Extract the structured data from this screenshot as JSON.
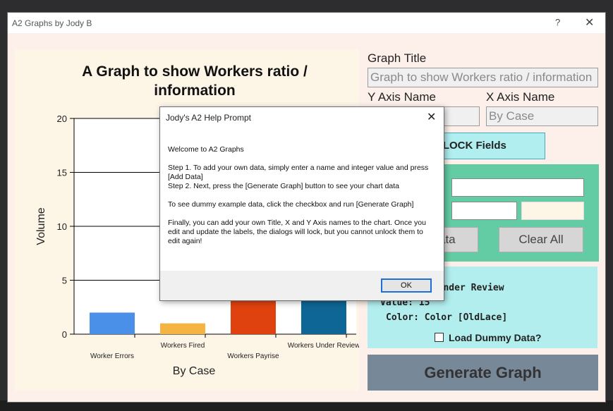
{
  "window": {
    "title": "A2 Graphs by Jody B",
    "help_glyph": "?",
    "close_glyph": "✕"
  },
  "chart_data": {
    "type": "bar",
    "title": "A Graph to show Workers ratio / information",
    "xlabel": "By Case",
    "ylabel": "Volume",
    "ylim": [
      0,
      20
    ],
    "yticks": [
      0,
      5,
      10,
      15,
      20
    ],
    "categories": [
      "Worker Errors",
      "Workers Fired",
      "Workers Payrise",
      "Workers Under Review"
    ],
    "values": [
      2,
      1,
      15,
      15
    ],
    "colors": [
      "#4a8fe8",
      "#f5b441",
      "#e0420f",
      "#0e6696"
    ],
    "grid": true
  },
  "form": {
    "graph_title_label": "Graph Title",
    "graph_title_value": "Graph to show Workers ratio / information",
    "y_axis_label": "Y Axis Name",
    "y_axis_value": "",
    "x_axis_label": "X Axis Name",
    "x_axis_value": "By Case",
    "unlock_button": "UNLOCK Fields",
    "add_data_button": "ata",
    "clear_all_button": "Clear All"
  },
  "info": {
    "line1": ":",
    "line2": "s Under Review",
    "line3": "Value: 15",
    "line4": "Color: Color [OldLace]",
    "dummy_checkbox_label": "Load Dummy Data?"
  },
  "generate_button": "Generate Graph",
  "dialog": {
    "title": "Jody's A2 Help Prompt",
    "close_glyph": "✕",
    "p1": "Welcome to A2 Graphs",
    "p2": "Step 1. To add your own data, simply enter a name and integer value and press [Add Data]",
    "p3": "Step 2. Next, press the [Generate Graph] button to see your chart data",
    "p4": "To see dummy example data, click the checkbox and run [Generate Graph]",
    "p5": "Finally, you can add your own Title, X and Y Axis names to the chart. Once you edit and update the labels, the dialogs will lock, but you cannot unlock them to edit again!",
    "ok_button": "OK"
  }
}
